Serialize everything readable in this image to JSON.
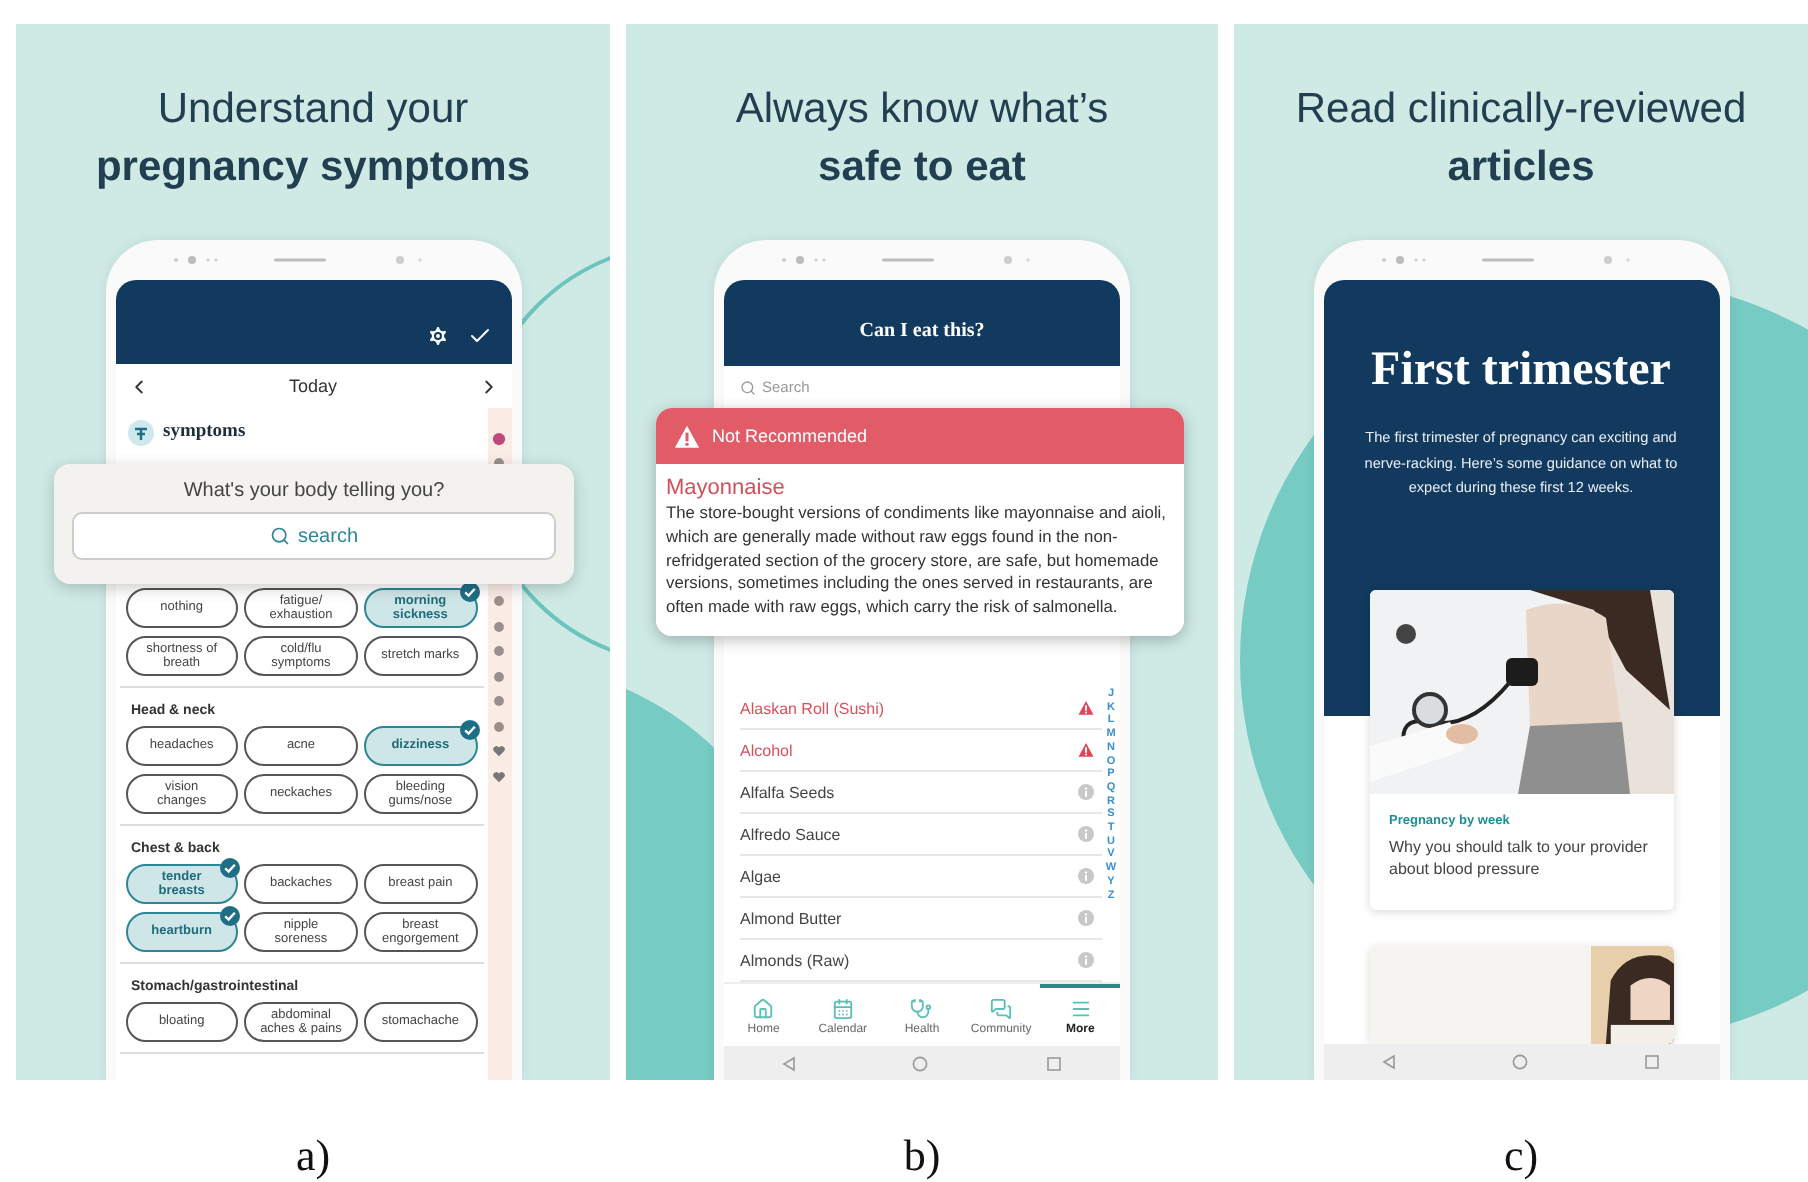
{
  "panels": [
    {
      "kind": "symptoms",
      "heading": [
        "Understand your",
        "**pregnancy symptoms**"
      ],
      "date_label": "Today",
      "section_title": "symptoms",
      "prompt": {
        "question": "What's your body telling you?",
        "search_label": "search"
      },
      "groups": [
        {
          "chips": [
            {
              "label": "nothing",
              "selected": false
            },
            {
              "label": "fatigue/ exhaustion",
              "selected": false
            },
            {
              "label": "morning sickness",
              "selected": true
            },
            {
              "label": "shortness of breath",
              "selected": false
            },
            {
              "label": "cold/flu symptoms",
              "selected": false
            },
            {
              "label": "stretch marks",
              "selected": false
            }
          ]
        },
        {
          "title": "Head & neck",
          "chips": [
            {
              "label": "headaches",
              "selected": false
            },
            {
              "label": "acne",
              "selected": false
            },
            {
              "label": "dizziness",
              "selected": true
            },
            {
              "label": "vision changes",
              "selected": false
            },
            {
              "label": "neckaches",
              "selected": false
            },
            {
              "label": "bleeding gums/nose",
              "selected": false
            }
          ]
        },
        {
          "title": "Chest & back",
          "chips": [
            {
              "label": "tender breasts",
              "selected": true
            },
            {
              "label": "backaches",
              "selected": false
            },
            {
              "label": "breast pain",
              "selected": false
            },
            {
              "label": "heartburn",
              "selected": true
            },
            {
              "label": "nipple soreness",
              "selected": false
            },
            {
              "label": "breast engorgement",
              "selected": false
            }
          ]
        },
        {
          "title": "Stomach/gastrointestinal",
          "chips": [
            {
              "label": "bloating",
              "selected": false
            },
            {
              "label": "abdominal aches & pains",
              "selected": false
            },
            {
              "label": "stomachache",
              "selected": false
            }
          ]
        }
      ],
      "caption": "a)"
    },
    {
      "kind": "food",
      "heading": [
        "Always know what’s",
        "**safe to eat**"
      ],
      "title": "Can I eat this?",
      "search": {
        "placeholder": "Search"
      },
      "alert": {
        "status": "Not Recommended",
        "food": "Mayonnaise",
        "text": "The store-bought versions of condiments like mayonnaise and aioli, which are generally made without raw eggs found in the non-refridgerated section of the grocery store, are safe, but homemade versions, sometimes including the ones served in restaurants, are often made with raw eggs, which carry the risk of salmonella."
      },
      "foods": [
        {
          "name": "Alaskan Roll (Sushi)",
          "kind": "warning"
        },
        {
          "name": "Alcohol",
          "kind": "warning"
        },
        {
          "name": "Alfalfa Seeds",
          "kind": "info"
        },
        {
          "name": "Alfredo Sauce",
          "kind": "info"
        },
        {
          "name": "Algae",
          "kind": "info"
        },
        {
          "name": "Almond Butter",
          "kind": "info"
        },
        {
          "name": "Almonds (Raw)",
          "kind": "info"
        }
      ],
      "index_letters": [
        "J",
        "K",
        "L",
        "M",
        "N",
        "O",
        "P",
        "Q",
        "R",
        "S",
        "T",
        "U",
        "V",
        "W",
        "Y",
        "Z"
      ],
      "nav": [
        {
          "label": "Home",
          "selected": false
        },
        {
          "label": "Calendar",
          "selected": false
        },
        {
          "label": "Health",
          "selected": false
        },
        {
          "label": "Community",
          "selected": false
        },
        {
          "label": "More",
          "selected": true
        }
      ],
      "caption": "b)"
    },
    {
      "kind": "articles",
      "heading": [
        "Read clinically-reviewed",
        "**articles**"
      ],
      "title": "First trimester",
      "intro": "The first trimester of pregnancy can exciting and nerve-racking. Here’s some guidance on what to expect during these first 12 weeks.",
      "articles": [
        {
          "kind": "full",
          "category": "Pregnancy by week",
          "title": "Why you should talk to your provider about blood pressure"
        },
        {
          "kind": "peek"
        }
      ],
      "caption": "c)"
    }
  ]
}
